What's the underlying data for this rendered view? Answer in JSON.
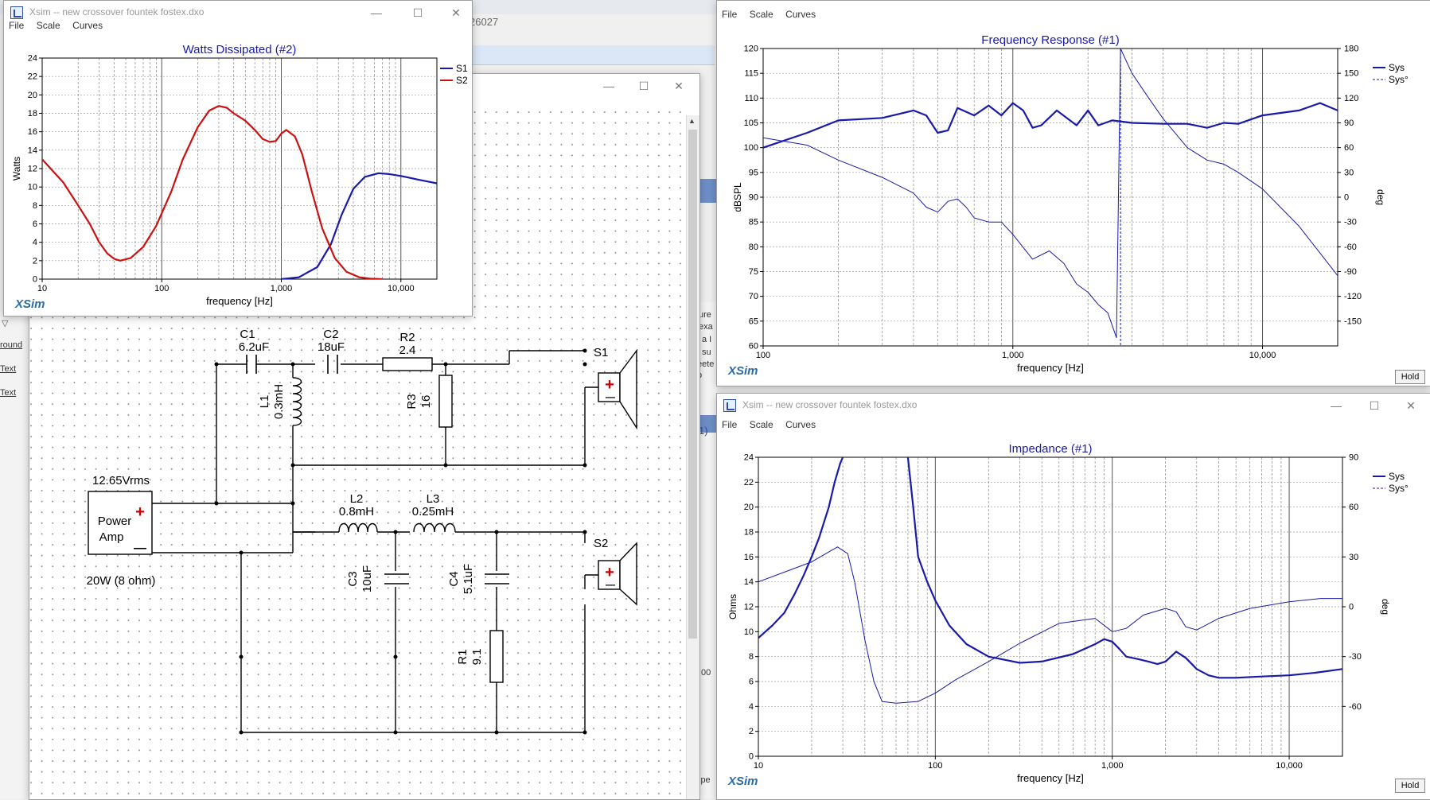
{
  "desktop": {
    "browser_fragment": "26027",
    "left_edge_items": [
      "round",
      "Text",
      "Text"
    ],
    "mid_edge_texts": [
      "ure",
      "exa",
      "a I",
      "su",
      "eete",
      "b"
    ],
    "mid_edge_small": [
      "1)",
      ",00",
      "jpe"
    ]
  },
  "window_controls": {
    "minimize": "—",
    "maximize": "☐",
    "close": "✕"
  },
  "watts_window": {
    "title": "Xsim -- new crossover fountek fostex.dxo",
    "menu": [
      "File",
      "Scale",
      "Curves"
    ],
    "brand": "XSim",
    "chart_data": {
      "type": "line",
      "title": "Watts Dissipated (#2)",
      "xlabel": "frequency [Hz]",
      "ylabel": "Watts",
      "xscale": "log",
      "xlim": [
        10,
        20000
      ],
      "ylim": [
        0,
        24
      ],
      "xticks": [
        10,
        100,
        1000,
        10000
      ],
      "xtick_labels": [
        "10",
        "100",
        "1,000",
        "10,000"
      ],
      "yticks": [
        0,
        2,
        4,
        6,
        8,
        10,
        12,
        14,
        16,
        18,
        20,
        22,
        24
      ],
      "legend": "top-right",
      "grid": true,
      "series": [
        {
          "name": "S1",
          "color": "#1a1aaa",
          "x": [
            1000,
            1400,
            2000,
            2600,
            3200,
            4000,
            5000,
            6500,
            8000,
            10000,
            14000,
            20000
          ],
          "y": [
            0,
            0.2,
            1.3,
            3.8,
            7,
            9.8,
            11.1,
            11.5,
            11.4,
            11.2,
            10.8,
            10.4
          ]
        },
        {
          "name": "S2",
          "color": "#cc1111",
          "x": [
            10,
            15,
            20,
            25,
            30,
            35,
            40,
            45,
            55,
            70,
            90,
            120,
            150,
            200,
            250,
            300,
            350,
            400,
            500,
            600,
            700,
            800,
            900,
            1000,
            1100,
            1300,
            1500,
            1800,
            2200,
            2800,
            3500,
            4500,
            5500,
            7000
          ],
          "y": [
            13,
            10.5,
            8,
            6,
            4,
            2.8,
            2.2,
            2,
            2.3,
            3.5,
            5.8,
            9.5,
            13,
            16.5,
            18.3,
            18.8,
            18.6,
            18,
            17.2,
            16.2,
            15.2,
            14.9,
            15,
            15.8,
            16.2,
            15.5,
            13.5,
            9.5,
            5.5,
            2.3,
            0.8,
            0.2,
            0.05,
            0
          ]
        }
      ]
    }
  },
  "freq_window": {
    "menu": [
      "File",
      "Scale",
      "Curves"
    ],
    "brand": "XSim",
    "hold_label": "Hold",
    "chart_data": {
      "type": "line",
      "title": "Frequency Response (#1)",
      "xlabel": "frequency [Hz]",
      "ylabel": "dBSPL",
      "y2label": "deg",
      "xscale": "log",
      "xlim": [
        100,
        20000
      ],
      "ylim": [
        60,
        120
      ],
      "y2lim": [
        -180,
        180
      ],
      "xticks": [
        100,
        1000,
        10000
      ],
      "xtick_labels": [
        "100",
        "1,000",
        "10,000"
      ],
      "yticks": [
        60,
        65,
        70,
        75,
        80,
        85,
        90,
        95,
        100,
        105,
        110,
        115,
        120
      ],
      "y2ticks": [
        -150,
        -120,
        -90,
        -60,
        -30,
        0,
        30,
        60,
        90,
        120,
        150,
        180
      ],
      "legend": "top-right",
      "grid": true,
      "series": [
        {
          "name": "Sys",
          "axis": "left",
          "style": "solid",
          "color": "#1a1aaa",
          "x": [
            100,
            150,
            200,
            300,
            400,
            450,
            500,
            550,
            600,
            700,
            800,
            900,
            1000,
            1100,
            1200,
            1300,
            1500,
            1800,
            2000,
            2200,
            2500,
            3000,
            4000,
            5000,
            6000,
            7000,
            8000,
            10000,
            14000,
            17000,
            20000
          ],
          "y": [
            100,
            103,
            105.5,
            106,
            107.5,
            106.5,
            103,
            103.5,
            108,
            106.5,
            108.5,
            106.5,
            109,
            107.5,
            104,
            104.5,
            107.5,
            104.5,
            107.5,
            104.5,
            105.5,
            105,
            104.8,
            104.8,
            104,
            105,
            104.8,
            106.5,
            107.5,
            109,
            107.5
          ]
        },
        {
          "name": "Sys°",
          "axis": "right",
          "style": "dashed",
          "color": "#1a1aaa",
          "x": [
            100,
            150,
            200,
            300,
            400,
            450,
            500,
            550,
            600,
            650,
            700,
            800,
            900,
            1000,
            1200,
            1400,
            1600,
            1800,
            2000,
            2200,
            2400,
            2600,
            2700,
            3000,
            3500,
            4000,
            5000,
            6000,
            7000,
            8000,
            10000,
            14000,
            20000
          ],
          "y": [
            72,
            63,
            45,
            24,
            5,
            -12,
            -18,
            -5,
            -2,
            -12,
            -25,
            -30,
            -30,
            -45,
            -75,
            -65,
            -80,
            -105,
            -115,
            -130,
            -140,
            -170,
            180,
            150,
            120,
            95,
            60,
            45,
            40,
            30,
            10,
            -35,
            -95
          ]
        }
      ]
    }
  },
  "imp_window": {
    "title": "Xsim -- new crossover fountek fostex.dxo",
    "menu": [
      "File",
      "Scale",
      "Curves"
    ],
    "brand": "XSim",
    "hold_label": "Hold",
    "chart_data": {
      "type": "line",
      "title": "Impedance (#1)",
      "xlabel": "frequency [Hz]",
      "ylabel": "Ohms",
      "y2label": "deg",
      "xscale": "log",
      "xlim": [
        10,
        20000
      ],
      "ylim": [
        0,
        24
      ],
      "y2lim": [
        -90,
        90
      ],
      "xticks": [
        10,
        100,
        1000,
        10000
      ],
      "xtick_labels": [
        "10",
        "100",
        "1,000",
        "10,000"
      ],
      "yticks": [
        0,
        2,
        4,
        6,
        8,
        10,
        12,
        14,
        16,
        18,
        20,
        22,
        24
      ],
      "y2ticks": [
        -60,
        -30,
        0,
        30,
        60,
        90
      ],
      "legend": "top-right",
      "grid": true,
      "series": [
        {
          "name": "Sys",
          "axis": "left",
          "style": "solid",
          "color": "#1a1aaa",
          "segments": [
            {
              "x": [
                10,
                12,
                14,
                16,
                18,
                20,
                22,
                25,
                27,
                29,
                30
              ],
              "y": [
                9.5,
                10.5,
                11.5,
                13,
                14.5,
                16,
                17.5,
                20,
                22,
                23.5,
                24
              ]
            },
            {
              "x": [
                70,
                75,
                80,
                90,
                100,
                120,
                150,
                200,
                300,
                400,
                600,
                800,
                900,
                1000,
                1100,
                1200,
                1400,
                1600,
                1800,
                2000,
                2300,
                2600,
                3000,
                3500,
                4000,
                5000,
                7000,
                10000,
                14000,
                20000
              ],
              "y": [
                24,
                20,
                16,
                14,
                12.5,
                10.5,
                9,
                8,
                7.5,
                7.6,
                8.2,
                9,
                9.4,
                9.2,
                8.6,
                8,
                7.8,
                7.6,
                7.4,
                7.6,
                8.4,
                7.9,
                7,
                6.5,
                6.3,
                6.3,
                6.4,
                6.5,
                6.7,
                7
              ]
            }
          ]
        },
        {
          "name": "Sys°",
          "axis": "right",
          "style": "dashed",
          "color": "#1a1aaa",
          "x": [
            10,
            15,
            20,
            25,
            28,
            32,
            35,
            40,
            45,
            50,
            60,
            80,
            100,
            130,
            200,
            300,
            500,
            800,
            1000,
            1200,
            1500,
            2000,
            2300,
            2600,
            3000,
            4000,
            6000,
            10000,
            15000,
            20000
          ],
          "y": [
            15,
            22,
            27,
            33,
            36,
            32,
            15,
            -20,
            -45,
            -57,
            -58,
            -57,
            -52,
            -44,
            -33,
            -22,
            -10,
            -7,
            -15,
            -13,
            -5,
            -1,
            -3,
            -12,
            -14,
            -7,
            -1,
            3,
            5,
            5
          ]
        }
      ]
    }
  },
  "schematic": {
    "power_amp": {
      "label_line1": "Power",
      "label_line2": "Amp",
      "voltage": "12.65Vrms",
      "rating": "20W (8 ohm)",
      "plus": "+",
      "minus": "—"
    },
    "components": [
      {
        "id": "C1",
        "value": "6.2uF"
      },
      {
        "id": "C2",
        "value": "18uF"
      },
      {
        "id": "R2",
        "value": "2.4"
      },
      {
        "id": "L1",
        "value": "0.3mH"
      },
      {
        "id": "R3",
        "value": "16"
      },
      {
        "id": "L2",
        "value": "0.8mH"
      },
      {
        "id": "L3",
        "value": "0.25mH"
      },
      {
        "id": "C3",
        "value": "10uF"
      },
      {
        "id": "C4",
        "value": "5.1uF"
      },
      {
        "id": "R1",
        "value": "9.1"
      }
    ],
    "speakers": [
      {
        "id": "S1",
        "plus": "+",
        "minus": "—"
      },
      {
        "id": "S2",
        "plus": "+",
        "minus": "—"
      }
    ]
  }
}
